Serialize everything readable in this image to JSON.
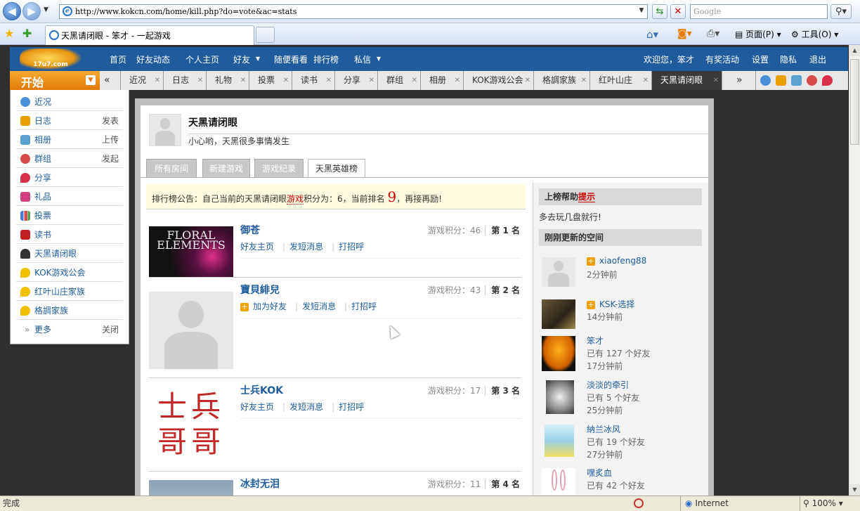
{
  "browser": {
    "url": "http://www.kokcn.com/home/kill.php?do=vote&ac=stats",
    "search_placeholder": "Google",
    "tab_title": "天黑请闭眼 - 笨才 - 一起游戏",
    "cmd_page": "页面(P)",
    "cmd_tools": "工具(O)",
    "status_text": "完成",
    "zone": "Internet",
    "zoom": "100%"
  },
  "site_nav": {
    "logo_text": "17u7.com",
    "items": [
      "首页",
      "好友动态",
      "个人主页",
      "好友",
      "随便看看",
      "排行榜",
      "私信"
    ],
    "right": [
      "欢迎您，笨才",
      "有奖活动",
      "设置",
      "隐私",
      "退出"
    ]
  },
  "app_bar": {
    "start_label": "开始",
    "tabs": [
      "近况",
      "日志",
      "礼物",
      "投票",
      "读书",
      "分享",
      "群组",
      "相册",
      "KOK游戏公会",
      "格調家族",
      "红叶山庄",
      "天黑请闭眼"
    ],
    "prev": "«",
    "next": "»"
  },
  "start_menu": {
    "items": [
      {
        "label": "近况",
        "sub": "",
        "color": "#4a90d9"
      },
      {
        "label": "日志",
        "sub": "发表",
        "color": "#e8a000"
      },
      {
        "label": "相册",
        "sub": "上传",
        "color": "#5aa0d0"
      },
      {
        "label": "群组",
        "sub": "发起",
        "color": "#d94a4a"
      },
      {
        "label": "分享",
        "sub": "",
        "color": "#d9304a"
      },
      {
        "label": "礼品",
        "sub": "",
        "color": "#d04080"
      },
      {
        "label": "投票",
        "sub": "",
        "color": "#4a7ad9"
      },
      {
        "label": "读书",
        "sub": "",
        "color": "#c02020"
      },
      {
        "label": "天黑请闭眼",
        "sub": "",
        "color": "#333333"
      },
      {
        "label": "KOK游戏公会",
        "sub": "",
        "color": "#f0c000"
      },
      {
        "label": "红叶山庄家族",
        "sub": "",
        "color": "#f0c000"
      },
      {
        "label": "格調家族",
        "sub": "",
        "color": "#f0c000"
      }
    ],
    "more": "更多",
    "close": "关闭"
  },
  "profile": {
    "title": "天黑请闭眼",
    "subtitle": "小心哟，天黑很多事情发生"
  },
  "page_tabs": [
    "所有房间",
    "新建游戏",
    "游戏纪录",
    "天黑英雄榜"
  ],
  "notice": {
    "prefix": "排行榜公告：自己当前的天黑请闭眼",
    "link": "游戏",
    "middle": "积分为：6，当前排名",
    "rank": "9",
    "suffix": "，再接再励!"
  },
  "ranking": [
    {
      "name": "御苍",
      "score": "游戏积分：46",
      "rank": "第 1 名",
      "actions": [
        "好友主页",
        "发短消息",
        "打招呼"
      ],
      "add": false,
      "thumb_text": "FLORAL ELEMENTS"
    },
    {
      "name": "寶貝緋兒",
      "score": "游戏积分：43",
      "rank": "第 2 名",
      "actions": [
        "加为好友",
        "发短消息",
        "打招呼"
      ],
      "add": true,
      "thumb_text": ""
    },
    {
      "name": "士兵KOK",
      "score": "游戏积分：17",
      "rank": "第 3 名",
      "actions": [
        "好友主页",
        "发短消息",
        "打招呼"
      ],
      "add": false,
      "thumb_text": "士兵哥哥"
    },
    {
      "name": "冰封无泪",
      "score": "游戏积分：11",
      "rank": "第 4 名",
      "actions": [],
      "add": false,
      "thumb_text": ""
    }
  ],
  "sidebar": {
    "help_title": "上榜帮助",
    "help_link": "提示",
    "help_text": "多去玩几盘就行!",
    "updates_title": "刚刚更新的空间",
    "updates": [
      {
        "name": "xiaofeng88",
        "plus": true,
        "friends": "",
        "time": "2分钟前"
      },
      {
        "name": "KSK-选择",
        "plus": true,
        "friends": "",
        "time": "14分钟前"
      },
      {
        "name": "笨才",
        "plus": false,
        "friends": "已有 127 个好友",
        "time": "17分钟前"
      },
      {
        "name": "淡淡的牵引",
        "plus": false,
        "friends": "已有 5 个好友",
        "time": "25分钟前"
      },
      {
        "name": "納兰冰风",
        "plus": false,
        "friends": "已有 19 个好友",
        "time": "27分钟前"
      },
      {
        "name": "嘿炙血",
        "plus": false,
        "friends": "已有 42 个好友",
        "time": ""
      }
    ]
  }
}
